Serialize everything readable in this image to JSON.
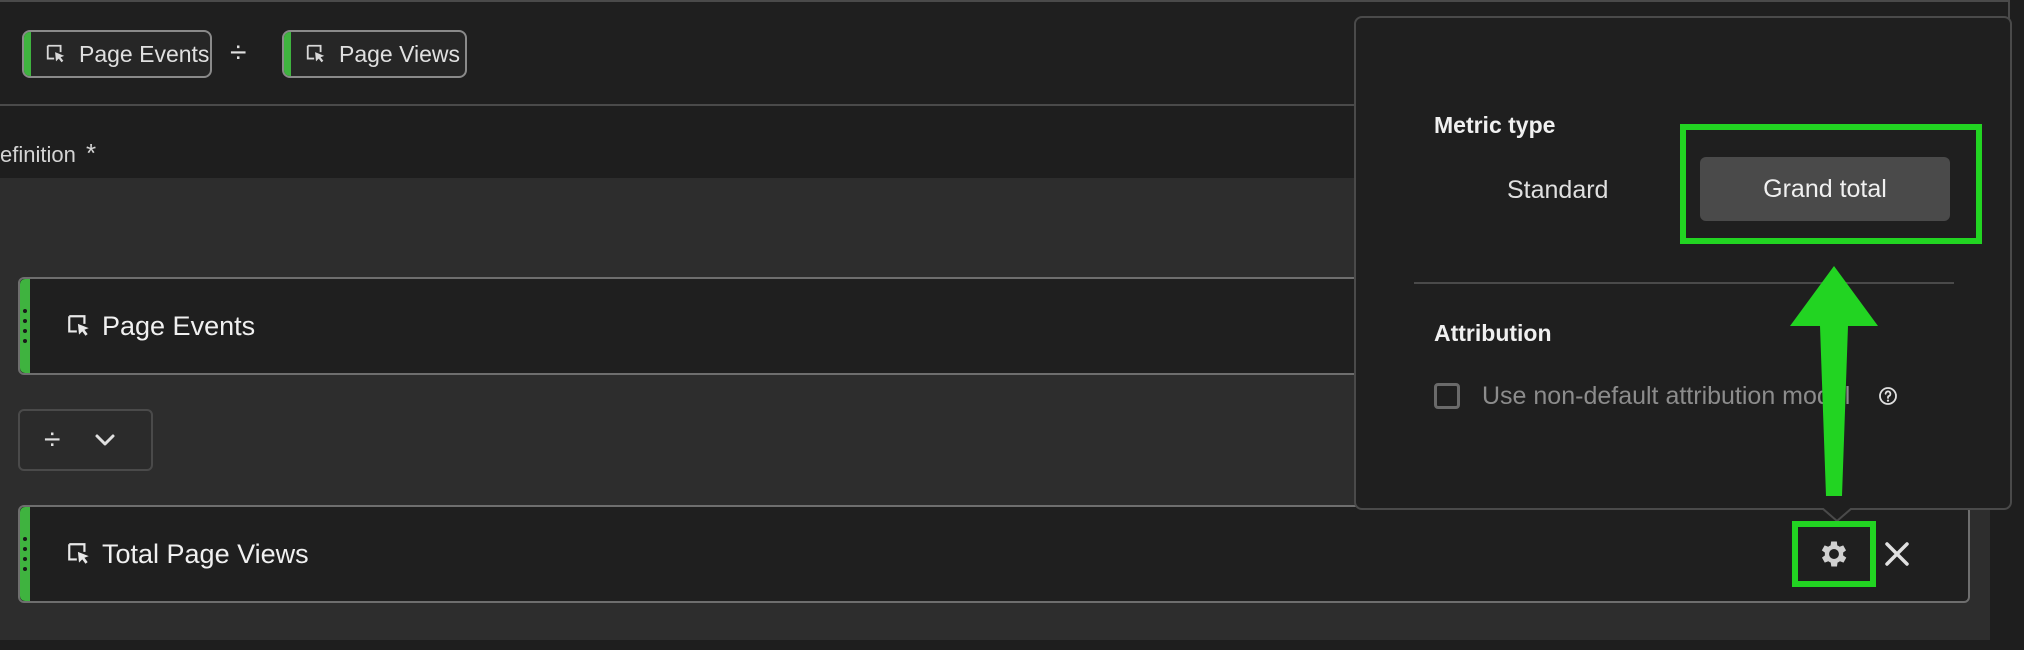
{
  "formula": {
    "chips": [
      {
        "label": "Page Events"
      },
      {
        "label": "Page Views"
      }
    ],
    "operator": "÷"
  },
  "definition_label": "efinition",
  "required_mark": "*",
  "definition": {
    "rows": [
      {
        "label": "Page Events"
      },
      {
        "label": "Total Page Views"
      }
    ],
    "operator": "÷"
  },
  "popover": {
    "metric_type_heading": "Metric type",
    "segments": [
      "Standard",
      "Grand total"
    ],
    "selected_segment": "Grand total",
    "attribution_heading": "Attribution",
    "checkbox_label": "Use non-default attribution model",
    "checkbox_checked": false
  },
  "colors": {
    "accent_green": "#3fb33f",
    "annotation_green": "#22d422",
    "background": "#1e1e1e"
  },
  "icons": [
    "metric-pointer-icon",
    "divide-icon",
    "chevron-down-icon",
    "gear-icon",
    "close-icon",
    "help-icon",
    "arrow-up-icon"
  ]
}
